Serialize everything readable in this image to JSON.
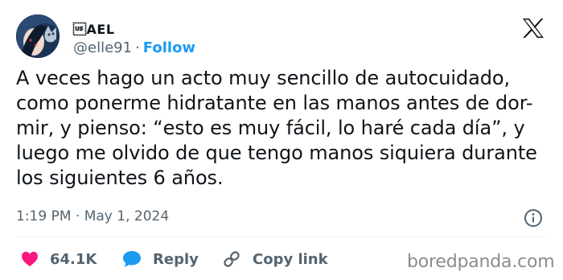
{
  "author": {
    "display_name": "\u001fAEL",
    "handle": "@elle91",
    "separator": "·",
    "follow_label": "Follow"
  },
  "tweet": {
    "lines": [
      "A veces hago un acto muy sencillo de autocuidado,",
      "como ponerme hidratante en las manos antes de dor-",
      "mir, y pienso: “esto es muy fácil, lo haré cada día”, y",
      "luego me olvido de que tengo manos siquiera durante",
      "los siguientes 6 años."
    ],
    "time": "1:19 PM",
    "date": "May 1, 2024",
    "meta_separator": "·"
  },
  "actions": {
    "likes_count": "64.1K",
    "reply_label": "Reply",
    "copy_link_label": "Copy link"
  },
  "watermark": "boredpanda.com",
  "icons": {
    "like": "heart-icon",
    "reply": "speech-bubble-icon",
    "copy": "link-icon",
    "info": "info-icon",
    "brand": "x-logo-icon"
  },
  "colors": {
    "accent": "#1d9bf0",
    "like": "#f91880",
    "text": "#0f1419",
    "muted": "#536471",
    "divider": "#eff3f4",
    "watermark": "#8c8c8c"
  }
}
